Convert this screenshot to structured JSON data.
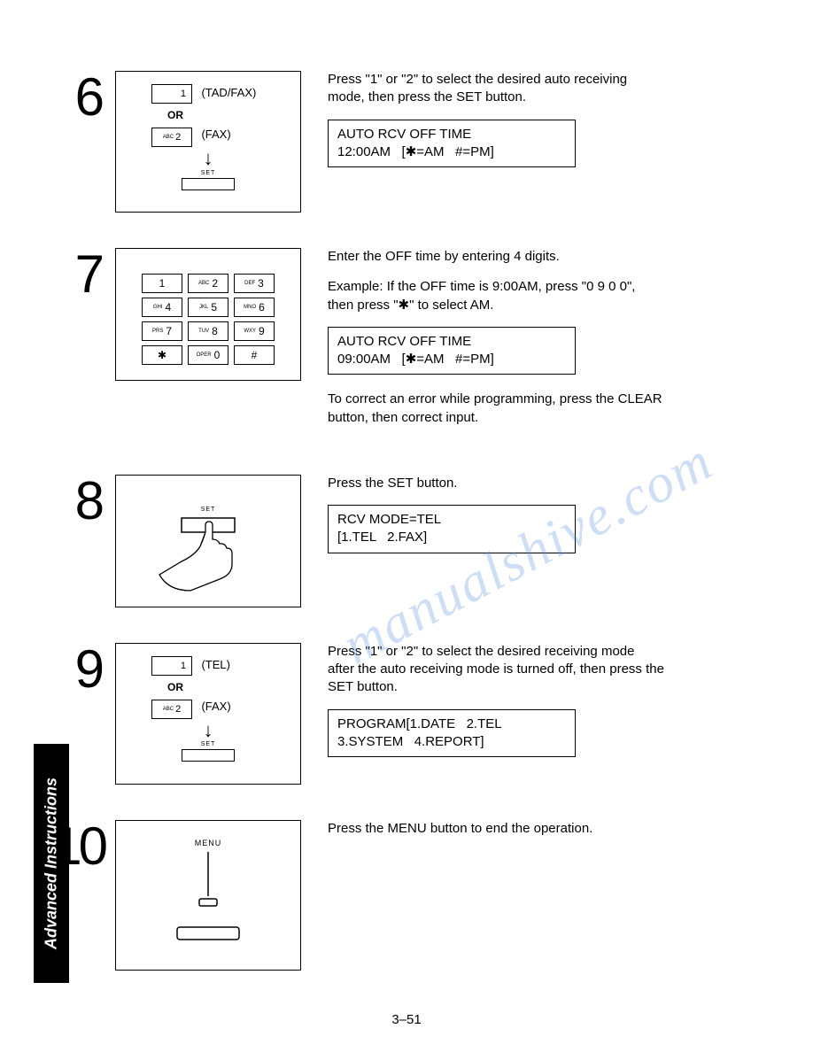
{
  "sideTab": "Advanced Instructions",
  "pageNumber": "3–51",
  "watermark": "manualshive.com",
  "steps": {
    "s6": {
      "num": "6",
      "key1": "1",
      "key1_label": "(TAD/FAX)",
      "or": "OR",
      "key2_sub": "ABC",
      "key2": "2",
      "key2_label": "(FAX)",
      "set": "SET",
      "desc": "Press \"1\" or \"2\" to select the desired auto receiving mode, then press the SET button.",
      "lcd": "AUTO RCV OFF TIME\n12:00AM   [✱=AM   #=PM]"
    },
    "s7": {
      "num": "7",
      "keys": [
        {
          "sub": "",
          "n": "1"
        },
        {
          "sub": "ABC",
          "n": "2"
        },
        {
          "sub": "DEF",
          "n": "3"
        },
        {
          "sub": "GHI",
          "n": "4"
        },
        {
          "sub": "JKL",
          "n": "5"
        },
        {
          "sub": "MNO",
          "n": "6"
        },
        {
          "sub": "PRS",
          "n": "7"
        },
        {
          "sub": "TUV",
          "n": "8"
        },
        {
          "sub": "WXY",
          "n": "9"
        },
        {
          "sub": "",
          "n": "✱"
        },
        {
          "sub": "OPER",
          "n": "0"
        },
        {
          "sub": "",
          "n": "#"
        }
      ],
      "desc1": "Enter the OFF time by entering 4 digits.",
      "desc2": "Example:  If the OFF time is 9:00AM, press \"0 9 0 0\", then press \"✱\" to select AM.",
      "lcd": "AUTO RCV OFF TIME\n09:00AM   [✱=AM   #=PM]",
      "desc3": "To correct an error while programming, press the CLEAR button, then correct input."
    },
    "s8": {
      "num": "8",
      "set": "SET",
      "desc": "Press the SET button.",
      "lcd": "RCV MODE=TEL\n[1.TEL   2.FAX]"
    },
    "s9": {
      "num": "9",
      "key1": "1",
      "key1_label": "(TEL)",
      "or": "OR",
      "key2_sub": "ABC",
      "key2": "2",
      "key2_label": "(FAX)",
      "set": "SET",
      "desc": "Press \"1\" or \"2\" to select the desired receiving mode after the auto receiving mode is turned off, then press the SET button.",
      "lcd": "PROGRAM[1.DATE   2.TEL\n3.SYSTEM   4.REPORT]"
    },
    "s10": {
      "num": "10",
      "menu": "MENU",
      "desc": "Press the MENU button to end the operation."
    }
  }
}
